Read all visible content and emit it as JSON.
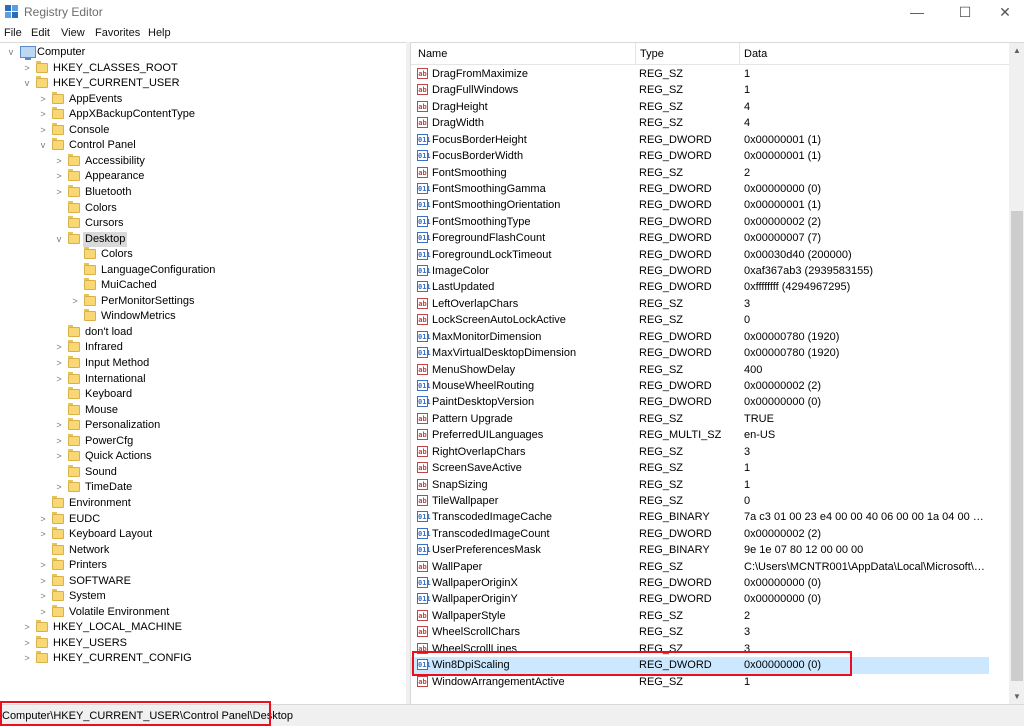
{
  "window": {
    "title": "Registry Editor",
    "controls": {
      "minimize": "—",
      "maximize": "☐",
      "close": "✕"
    }
  },
  "menu": [
    "File",
    "Edit",
    "View",
    "Favorites",
    "Help"
  ],
  "tree": [
    {
      "label": "Computer",
      "level": 0,
      "expander": "v",
      "icon": "computer-icon"
    },
    {
      "label": "HKEY_CLASSES_ROOT",
      "level": 1,
      "expander": ">"
    },
    {
      "label": "HKEY_CURRENT_USER",
      "level": 1,
      "expander": "v"
    },
    {
      "label": "AppEvents",
      "level": 2,
      "expander": ">"
    },
    {
      "label": "AppXBackupContentType",
      "level": 2,
      "expander": ">"
    },
    {
      "label": "Console",
      "level": 2,
      "expander": ">"
    },
    {
      "label": "Control Panel",
      "level": 2,
      "expander": "v"
    },
    {
      "label": "Accessibility",
      "level": 3,
      "expander": ">"
    },
    {
      "label": "Appearance",
      "level": 3,
      "expander": ">"
    },
    {
      "label": "Bluetooth",
      "level": 3,
      "expander": ">"
    },
    {
      "label": "Colors",
      "level": 3,
      "expander": ""
    },
    {
      "label": "Cursors",
      "level": 3,
      "expander": ""
    },
    {
      "label": "Desktop",
      "level": 3,
      "expander": "v",
      "selected": true
    },
    {
      "label": "Colors",
      "level": 4,
      "expander": ""
    },
    {
      "label": "LanguageConfiguration",
      "level": 4,
      "expander": ""
    },
    {
      "label": "MuiCached",
      "level": 4,
      "expander": ""
    },
    {
      "label": "PerMonitorSettings",
      "level": 4,
      "expander": ">"
    },
    {
      "label": "WindowMetrics",
      "level": 4,
      "expander": ""
    },
    {
      "label": "don't load",
      "level": 3,
      "expander": ""
    },
    {
      "label": "Infrared",
      "level": 3,
      "expander": ">"
    },
    {
      "label": "Input Method",
      "level": 3,
      "expander": ">"
    },
    {
      "label": "International",
      "level": 3,
      "expander": ">"
    },
    {
      "label": "Keyboard",
      "level": 3,
      "expander": ""
    },
    {
      "label": "Mouse",
      "level": 3,
      "expander": ""
    },
    {
      "label": "Personalization",
      "level": 3,
      "expander": ">"
    },
    {
      "label": "PowerCfg",
      "level": 3,
      "expander": ">"
    },
    {
      "label": "Quick Actions",
      "level": 3,
      "expander": ">"
    },
    {
      "label": "Sound",
      "level": 3,
      "expander": ""
    },
    {
      "label": "TimeDate",
      "level": 3,
      "expander": ">"
    },
    {
      "label": "Environment",
      "level": 2,
      "expander": ""
    },
    {
      "label": "EUDC",
      "level": 2,
      "expander": ">"
    },
    {
      "label": "Keyboard Layout",
      "level": 2,
      "expander": ">"
    },
    {
      "label": "Network",
      "level": 2,
      "expander": ""
    },
    {
      "label": "Printers",
      "level": 2,
      "expander": ">"
    },
    {
      "label": "SOFTWARE",
      "level": 2,
      "expander": ">"
    },
    {
      "label": "System",
      "level": 2,
      "expander": ">"
    },
    {
      "label": "Volatile Environment",
      "level": 2,
      "expander": ">"
    },
    {
      "label": "HKEY_LOCAL_MACHINE",
      "level": 1,
      "expander": ">"
    },
    {
      "label": "HKEY_USERS",
      "level": 1,
      "expander": ">"
    },
    {
      "label": "HKEY_CURRENT_CONFIG",
      "level": 1,
      "expander": ">"
    }
  ],
  "list": {
    "columns": [
      "Name",
      "Type",
      "Data"
    ],
    "rows": [
      {
        "name": "DragFromMaximize",
        "type": "REG_SZ",
        "data": "1",
        "icon": "sz"
      },
      {
        "name": "DragFullWindows",
        "type": "REG_SZ",
        "data": "1",
        "icon": "sz"
      },
      {
        "name": "DragHeight",
        "type": "REG_SZ",
        "data": "4",
        "icon": "sz"
      },
      {
        "name": "DragWidth",
        "type": "REG_SZ",
        "data": "4",
        "icon": "sz"
      },
      {
        "name": "FocusBorderHeight",
        "type": "REG_DWORD",
        "data": "0x00000001 (1)",
        "icon": "bin"
      },
      {
        "name": "FocusBorderWidth",
        "type": "REG_DWORD",
        "data": "0x00000001 (1)",
        "icon": "bin"
      },
      {
        "name": "FontSmoothing",
        "type": "REG_SZ",
        "data": "2",
        "icon": "sz"
      },
      {
        "name": "FontSmoothingGamma",
        "type": "REG_DWORD",
        "data": "0x00000000 (0)",
        "icon": "bin"
      },
      {
        "name": "FontSmoothingOrientation",
        "type": "REG_DWORD",
        "data": "0x00000001 (1)",
        "icon": "bin"
      },
      {
        "name": "FontSmoothingType",
        "type": "REG_DWORD",
        "data": "0x00000002 (2)",
        "icon": "bin"
      },
      {
        "name": "ForegroundFlashCount",
        "type": "REG_DWORD",
        "data": "0x00000007 (7)",
        "icon": "bin"
      },
      {
        "name": "ForegroundLockTimeout",
        "type": "REG_DWORD",
        "data": "0x00030d40 (200000)",
        "icon": "bin"
      },
      {
        "name": "ImageColor",
        "type": "REG_DWORD",
        "data": "0xaf367ab3 (2939583155)",
        "icon": "bin"
      },
      {
        "name": "LastUpdated",
        "type": "REG_DWORD",
        "data": "0xffffffff (4294967295)",
        "icon": "bin"
      },
      {
        "name": "LeftOverlapChars",
        "type": "REG_SZ",
        "data": "3",
        "icon": "sz"
      },
      {
        "name": "LockScreenAutoLockActive",
        "type": "REG_SZ",
        "data": "0",
        "icon": "sz"
      },
      {
        "name": "MaxMonitorDimension",
        "type": "REG_DWORD",
        "data": "0x00000780 (1920)",
        "icon": "bin"
      },
      {
        "name": "MaxVirtualDesktopDimension",
        "type": "REG_DWORD",
        "data": "0x00000780 (1920)",
        "icon": "bin"
      },
      {
        "name": "MenuShowDelay",
        "type": "REG_SZ",
        "data": "400",
        "icon": "sz"
      },
      {
        "name": "MouseWheelRouting",
        "type": "REG_DWORD",
        "data": "0x00000002 (2)",
        "icon": "bin"
      },
      {
        "name": "PaintDesktopVersion",
        "type": "REG_DWORD",
        "data": "0x00000000 (0)",
        "icon": "bin"
      },
      {
        "name": "Pattern Upgrade",
        "type": "REG_SZ",
        "data": "TRUE",
        "icon": "sz"
      },
      {
        "name": "PreferredUILanguages",
        "type": "REG_MULTI_SZ",
        "data": "en-US",
        "icon": "sz"
      },
      {
        "name": "RightOverlapChars",
        "type": "REG_SZ",
        "data": "3",
        "icon": "sz"
      },
      {
        "name": "ScreenSaveActive",
        "type": "REG_SZ",
        "data": "1",
        "icon": "sz"
      },
      {
        "name": "SnapSizing",
        "type": "REG_SZ",
        "data": "1",
        "icon": "sz"
      },
      {
        "name": "TileWallpaper",
        "type": "REG_SZ",
        "data": "0",
        "icon": "sz"
      },
      {
        "name": "TranscodedImageCache",
        "type": "REG_BINARY",
        "data": "7a c3 01 00 23 e4 00 00 40 06 00 00 1a 04 00 00 d0 9...",
        "icon": "bin"
      },
      {
        "name": "TranscodedImageCount",
        "type": "REG_DWORD",
        "data": "0x00000002 (2)",
        "icon": "bin"
      },
      {
        "name": "UserPreferencesMask",
        "type": "REG_BINARY",
        "data": "9e 1e 07 80 12 00 00 00",
        "icon": "bin"
      },
      {
        "name": "WallPaper",
        "type": "REG_SZ",
        "data": "C:\\Users\\MCNTR001\\AppData\\Local\\Microsoft\\W...",
        "icon": "sz"
      },
      {
        "name": "WallpaperOriginX",
        "type": "REG_DWORD",
        "data": "0x00000000 (0)",
        "icon": "bin"
      },
      {
        "name": "WallpaperOriginY",
        "type": "REG_DWORD",
        "data": "0x00000000 (0)",
        "icon": "bin"
      },
      {
        "name": "WallpaperStyle",
        "type": "REG_SZ",
        "data": "2",
        "icon": "sz"
      },
      {
        "name": "WheelScrollChars",
        "type": "REG_SZ",
        "data": "3",
        "icon": "sz"
      },
      {
        "name": "WheelScrollLines",
        "type": "REG_SZ",
        "data": "3",
        "icon": "sz"
      },
      {
        "name": "Win8DpiScaling",
        "type": "REG_DWORD",
        "data": "0x00000000 (0)",
        "icon": "bin",
        "selected": true
      },
      {
        "name": "WindowArrangementActive",
        "type": "REG_SZ",
        "data": "1",
        "icon": "sz"
      }
    ]
  },
  "statusbar": {
    "path": "Computer\\HKEY_CURRENT_USER\\Control Panel\\Desktop"
  },
  "scrollbar": {
    "up": "▲",
    "down": "▼"
  },
  "icons": {
    "sz": "ab",
    "bin": "011"
  },
  "colors": {
    "selection": "#cce8ff",
    "highlight_box": "#e8101c",
    "folder": "#f8d775"
  }
}
